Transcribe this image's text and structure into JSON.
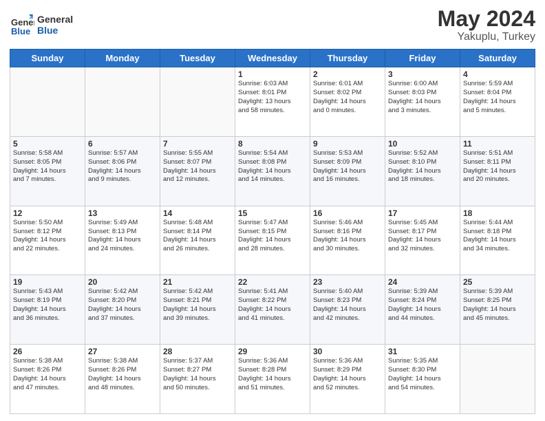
{
  "logo": {
    "line1": "General",
    "line2": "Blue"
  },
  "title": "May 2024",
  "location": "Yakuplu, Turkey",
  "days_header": [
    "Sunday",
    "Monday",
    "Tuesday",
    "Wednesday",
    "Thursday",
    "Friday",
    "Saturday"
  ],
  "weeks": [
    [
      {
        "day": "",
        "text": ""
      },
      {
        "day": "",
        "text": ""
      },
      {
        "day": "",
        "text": ""
      },
      {
        "day": "1",
        "text": "Sunrise: 6:03 AM\nSunset: 8:01 PM\nDaylight: 13 hours\nand 58 minutes."
      },
      {
        "day": "2",
        "text": "Sunrise: 6:01 AM\nSunset: 8:02 PM\nDaylight: 14 hours\nand 0 minutes."
      },
      {
        "day": "3",
        "text": "Sunrise: 6:00 AM\nSunset: 8:03 PM\nDaylight: 14 hours\nand 3 minutes."
      },
      {
        "day": "4",
        "text": "Sunrise: 5:59 AM\nSunset: 8:04 PM\nDaylight: 14 hours\nand 5 minutes."
      }
    ],
    [
      {
        "day": "5",
        "text": "Sunrise: 5:58 AM\nSunset: 8:05 PM\nDaylight: 14 hours\nand 7 minutes."
      },
      {
        "day": "6",
        "text": "Sunrise: 5:57 AM\nSunset: 8:06 PM\nDaylight: 14 hours\nand 9 minutes."
      },
      {
        "day": "7",
        "text": "Sunrise: 5:55 AM\nSunset: 8:07 PM\nDaylight: 14 hours\nand 12 minutes."
      },
      {
        "day": "8",
        "text": "Sunrise: 5:54 AM\nSunset: 8:08 PM\nDaylight: 14 hours\nand 14 minutes."
      },
      {
        "day": "9",
        "text": "Sunrise: 5:53 AM\nSunset: 8:09 PM\nDaylight: 14 hours\nand 16 minutes."
      },
      {
        "day": "10",
        "text": "Sunrise: 5:52 AM\nSunset: 8:10 PM\nDaylight: 14 hours\nand 18 minutes."
      },
      {
        "day": "11",
        "text": "Sunrise: 5:51 AM\nSunset: 8:11 PM\nDaylight: 14 hours\nand 20 minutes."
      }
    ],
    [
      {
        "day": "12",
        "text": "Sunrise: 5:50 AM\nSunset: 8:12 PM\nDaylight: 14 hours\nand 22 minutes."
      },
      {
        "day": "13",
        "text": "Sunrise: 5:49 AM\nSunset: 8:13 PM\nDaylight: 14 hours\nand 24 minutes."
      },
      {
        "day": "14",
        "text": "Sunrise: 5:48 AM\nSunset: 8:14 PM\nDaylight: 14 hours\nand 26 minutes."
      },
      {
        "day": "15",
        "text": "Sunrise: 5:47 AM\nSunset: 8:15 PM\nDaylight: 14 hours\nand 28 minutes."
      },
      {
        "day": "16",
        "text": "Sunrise: 5:46 AM\nSunset: 8:16 PM\nDaylight: 14 hours\nand 30 minutes."
      },
      {
        "day": "17",
        "text": "Sunrise: 5:45 AM\nSunset: 8:17 PM\nDaylight: 14 hours\nand 32 minutes."
      },
      {
        "day": "18",
        "text": "Sunrise: 5:44 AM\nSunset: 8:18 PM\nDaylight: 14 hours\nand 34 minutes."
      }
    ],
    [
      {
        "day": "19",
        "text": "Sunrise: 5:43 AM\nSunset: 8:19 PM\nDaylight: 14 hours\nand 36 minutes."
      },
      {
        "day": "20",
        "text": "Sunrise: 5:42 AM\nSunset: 8:20 PM\nDaylight: 14 hours\nand 37 minutes."
      },
      {
        "day": "21",
        "text": "Sunrise: 5:42 AM\nSunset: 8:21 PM\nDaylight: 14 hours\nand 39 minutes."
      },
      {
        "day": "22",
        "text": "Sunrise: 5:41 AM\nSunset: 8:22 PM\nDaylight: 14 hours\nand 41 minutes."
      },
      {
        "day": "23",
        "text": "Sunrise: 5:40 AM\nSunset: 8:23 PM\nDaylight: 14 hours\nand 42 minutes."
      },
      {
        "day": "24",
        "text": "Sunrise: 5:39 AM\nSunset: 8:24 PM\nDaylight: 14 hours\nand 44 minutes."
      },
      {
        "day": "25",
        "text": "Sunrise: 5:39 AM\nSunset: 8:25 PM\nDaylight: 14 hours\nand 45 minutes."
      }
    ],
    [
      {
        "day": "26",
        "text": "Sunrise: 5:38 AM\nSunset: 8:26 PM\nDaylight: 14 hours\nand 47 minutes."
      },
      {
        "day": "27",
        "text": "Sunrise: 5:38 AM\nSunset: 8:26 PM\nDaylight: 14 hours\nand 48 minutes."
      },
      {
        "day": "28",
        "text": "Sunrise: 5:37 AM\nSunset: 8:27 PM\nDaylight: 14 hours\nand 50 minutes."
      },
      {
        "day": "29",
        "text": "Sunrise: 5:36 AM\nSunset: 8:28 PM\nDaylight: 14 hours\nand 51 minutes."
      },
      {
        "day": "30",
        "text": "Sunrise: 5:36 AM\nSunset: 8:29 PM\nDaylight: 14 hours\nand 52 minutes."
      },
      {
        "day": "31",
        "text": "Sunrise: 5:35 AM\nSunset: 8:30 PM\nDaylight: 14 hours\nand 54 minutes."
      },
      {
        "day": "",
        "text": ""
      }
    ]
  ]
}
